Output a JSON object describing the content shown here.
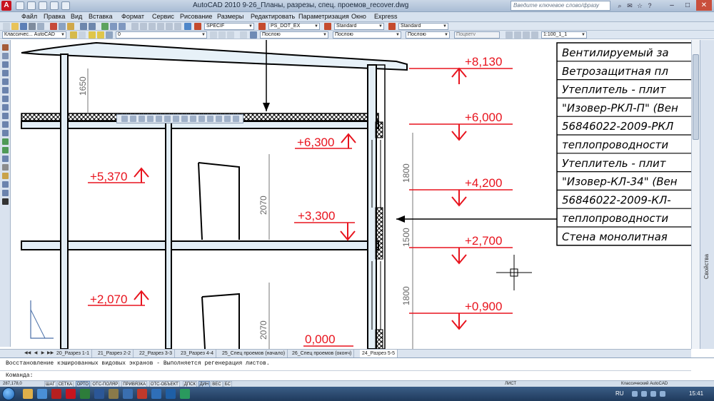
{
  "window": {
    "title": "AutoCAD 2010    9-26_Планы, разрезы, спец. проемов_recover.dwg",
    "search_placeholder": "Введите ключевое слово/фразу"
  },
  "menu": [
    "Файл",
    "Правка",
    "Вид",
    "Вставка",
    "Формат",
    "Сервис",
    "Рисование",
    "Размеры",
    "Редактировать",
    "Параметризация",
    "Окно",
    "Express"
  ],
  "toolbar1": {
    "text_style": "SPECIF",
    "dim_style": "PS_DOT_EX",
    "table_style": "Standard",
    "mleader_style": "Standard"
  },
  "toolbar2": {
    "workspace": "Классичес... AutoCAD",
    "layer": "0",
    "color": "Послою",
    "linetype": "Послою",
    "lineweight": "Послою",
    "plotstyle": "Поцветv",
    "scale": "1:100_1_1"
  },
  "legend_table": [
    "Вентилируемый за",
    "Ветрозащитная пл",
    "Утеплитель - плит",
    "\"Изовер-РКЛ-П\" (Вен",
    "56846022-2009-РКЛ",
    "теплопроводности",
    "Утеплитель - плит",
    "\"Изовер-КЛ-34\" (Вен",
    "56846022-2009-КЛ-",
    "теплопроводности",
    "Стена монолитная"
  ],
  "levels": {
    "left": [
      "+5,370",
      "+2,070"
    ],
    "center": [
      "+6,300",
      "+3,300",
      "0,000"
    ],
    "right": [
      "+8,130",
      "+6,000",
      "+4,200",
      "+2,700",
      "+0,900"
    ]
  },
  "dimensions": [
    "1650",
    "2070",
    "2070",
    "1800",
    "1500",
    "1800"
  ],
  "layout_tabs": [
    "20_Разрез 1-1",
    "21_Разрез 2-2",
    "22_Разрез 3-3",
    "23_Разрез 4-4",
    "25_Спец проемов (начало)",
    "26_Спец проемов (оконч)",
    "24_Разрез 5-5"
  ],
  "active_tab": "24_Разрез 5-5",
  "command": {
    "history": "Восстановление кэшированных видовых экранов - Выполняется регенерация листов.",
    "prompt": "Команда:"
  },
  "status": {
    "coords": "287,178,0",
    "toggles": [
      "ШАГ",
      "СЕТКА",
      "ОРТО",
      "ОТС-ПОЛЯР",
      "ПРИВЯЗКА",
      "ОТС-ОБЪЕКТ",
      "ДПСК",
      "ДИН",
      "ВЕС",
      "БС"
    ],
    "toggles_on": [
      "ОРТО",
      "ДИН"
    ],
    "model": "ЛИСТ",
    "workspace": "Классический AutoCAD"
  },
  "properties_label": "Свойства",
  "taskbar": {
    "lang": "RU",
    "time": "15:41"
  },
  "colors": {
    "level_red": "#e8141e",
    "taskbar": "#1f3a5c",
    "titlebar": "#a9bcd4"
  }
}
